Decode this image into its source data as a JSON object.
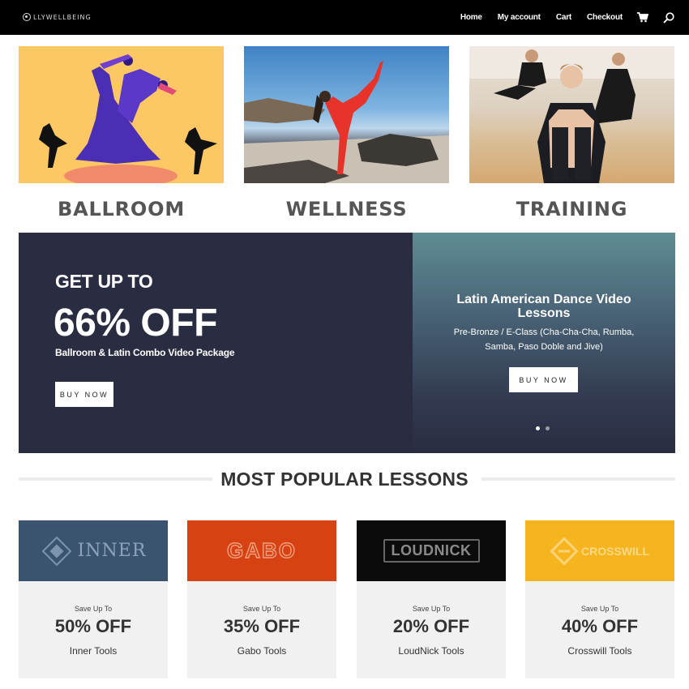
{
  "header": {
    "logo_text": "LLYWELLBEING",
    "nav": [
      "Home",
      "My account",
      "Cart",
      "Checkout"
    ],
    "icons": [
      "cart-icon",
      "search-icon"
    ]
  },
  "categories": [
    {
      "title": "BALLROOM"
    },
    {
      "title": "WELLNESS"
    },
    {
      "title": "TRAINING"
    }
  ],
  "promo": {
    "kicker": "GET UP TO",
    "big": "66% OFF",
    "sub": "Ballroom & Latin Combo Video Package",
    "button": "BUY NOW",
    "right_title": "Latin American Dance Video Lessons",
    "right_desc": "Pre-Bronze / E-Class (Cha-Cha-Cha, Rumba, Samba, Paso Doble and Jive)",
    "right_button": "BUY NOW",
    "slides": 2,
    "active_slide": 1
  },
  "section": {
    "title": "MOST POPULAR LESSONS"
  },
  "cards": [
    {
      "brand": "INNER",
      "brand_bg": "#3a5470",
      "save": "Save Up To",
      "pct": "50% OFF",
      "name": "Inner Tools"
    },
    {
      "brand": "GABO",
      "brand_bg": "#d64211",
      "save": "Save Up To",
      "pct": "35% OFF",
      "name": "Gabo Tools"
    },
    {
      "brand": "LOUDNICK",
      "brand_bg": "#0b0b0b",
      "save": "Save Up To",
      "pct": "20% OFF",
      "name": "LoudNick Tools"
    },
    {
      "brand": "CROSSWILL",
      "brand_bg": "#f6b51e",
      "save": "Save Up To",
      "pct": "40% OFF",
      "name": "Crosswill Tools"
    }
  ],
  "colors": {
    "nav_bg": "#000000",
    "promo_bg": "#2a2d42",
    "card_bg": "#f1f1f1"
  }
}
